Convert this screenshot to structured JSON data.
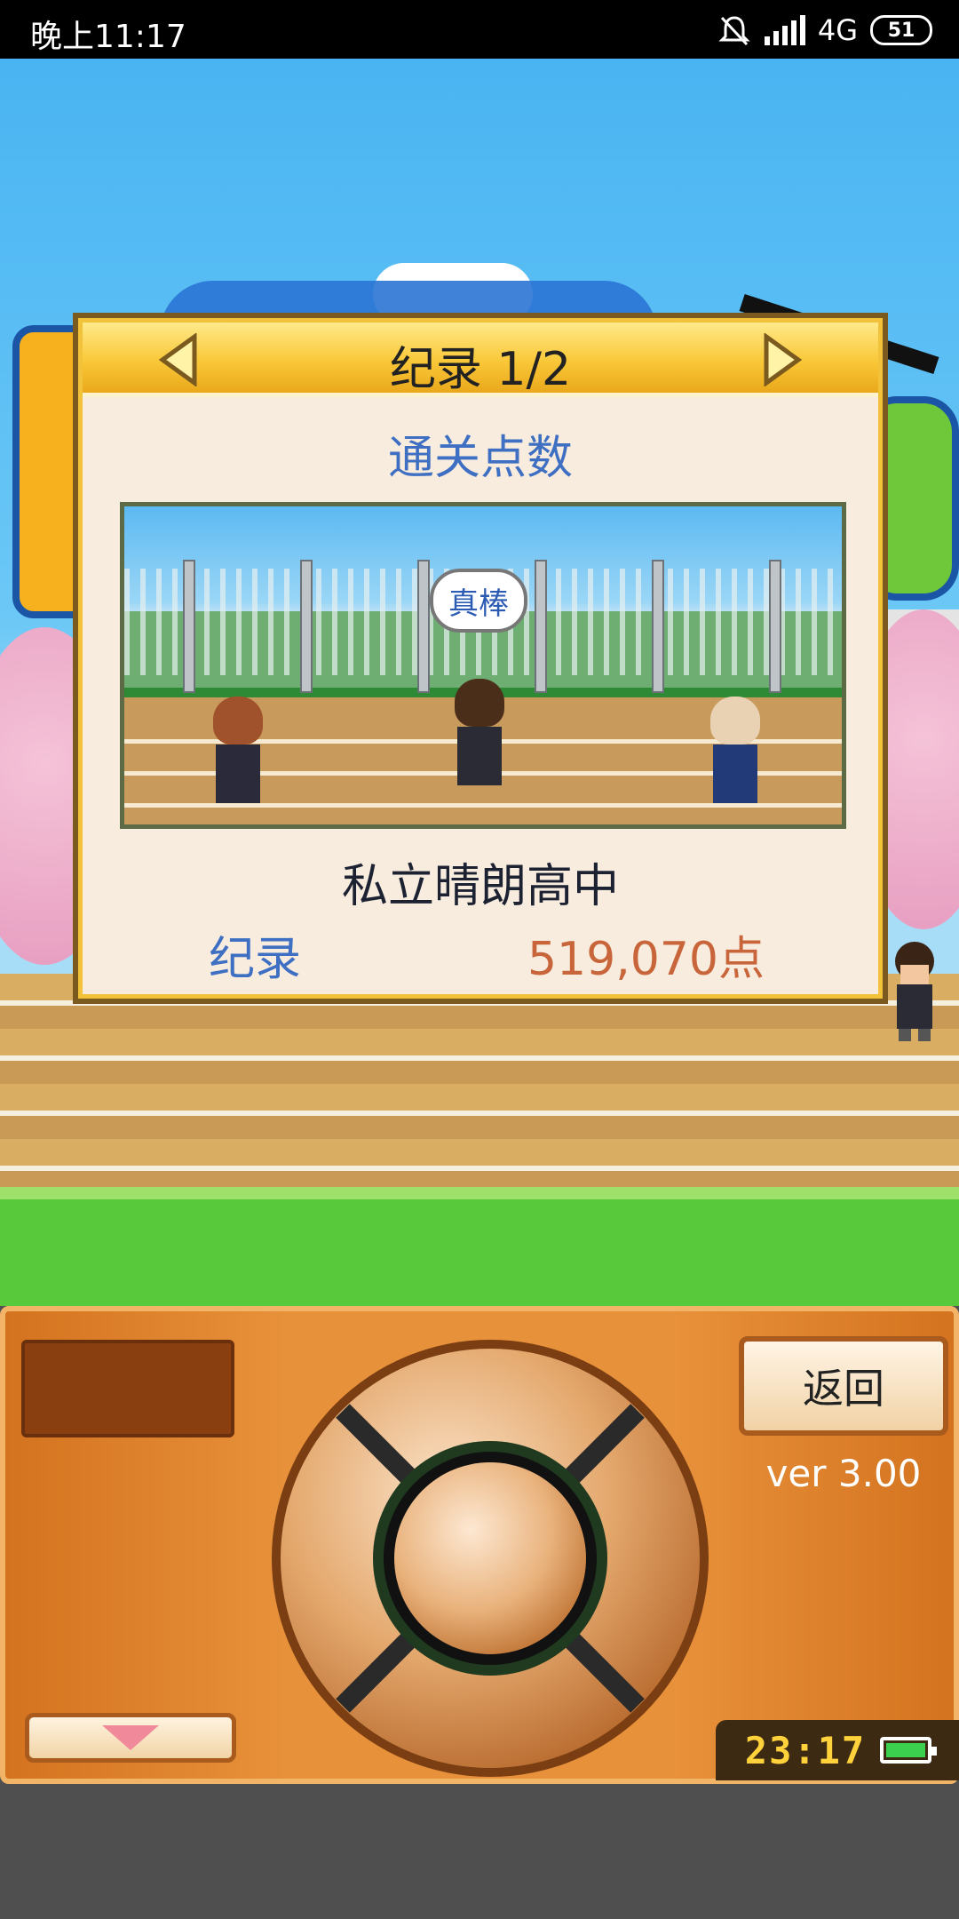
{
  "status_bar": {
    "time": "晚上11:17",
    "network": "4G",
    "battery": "51"
  },
  "dialog": {
    "title": "纪录 1/2",
    "subtitle": "通关点数",
    "speech_bubble": "真棒",
    "school_name": "私立晴朗高中",
    "record_label": "纪录",
    "record_value": "519,070点"
  },
  "controls": {
    "back_label": "返回",
    "version": "ver 3.00",
    "clock": "23:17"
  },
  "colors": {
    "title_bar": "#f9c838",
    "dialog_bg": "#f7ecdd",
    "label_blue": "#3e6fc3",
    "value_orange": "#c9653a",
    "pad_orange": "#e8913b"
  },
  "icons": [
    "left-arrow-icon",
    "right-arrow-icon",
    "mute-bell-icon",
    "signal-icon",
    "battery-icon",
    "down-arrow-icon"
  ]
}
